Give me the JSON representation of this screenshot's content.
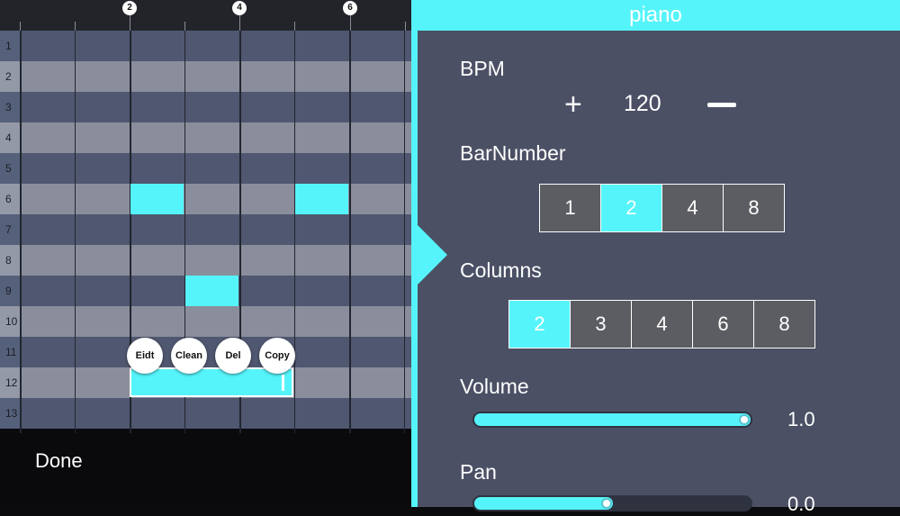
{
  "ruler": {
    "markers": [
      "2",
      "4",
      "6"
    ]
  },
  "grid": {
    "row_numbers": [
      "1",
      "2",
      "3",
      "4",
      "5",
      "6",
      "7",
      "8",
      "9",
      "10",
      "11",
      "12",
      "13"
    ]
  },
  "context_menu": {
    "edit": "Eidt",
    "clean": "Clean",
    "delete": "Del",
    "copy": "Copy"
  },
  "bottom": {
    "done_label": "Done"
  },
  "panel": {
    "title": "piano",
    "bpm": {
      "label": "BPM",
      "value": "120",
      "plus": "+",
      "minus": "—"
    },
    "bar_number": {
      "label": "BarNumber",
      "options": [
        "1",
        "2",
        "4",
        "8"
      ],
      "selected": "2"
    },
    "columns": {
      "label": "Columns",
      "options": [
        "2",
        "3",
        "4",
        "6",
        "8"
      ],
      "selected": "2"
    },
    "volume": {
      "label": "Volume",
      "value": "1.0",
      "level": 1.0
    },
    "pan": {
      "label": "Pan",
      "value": "0.0",
      "level": 0.5
    }
  },
  "colors": {
    "accent": "#55f4fa",
    "panel_bg": "#4b5065",
    "row_dark": "#505770",
    "row_light": "#8a8e9c"
  }
}
